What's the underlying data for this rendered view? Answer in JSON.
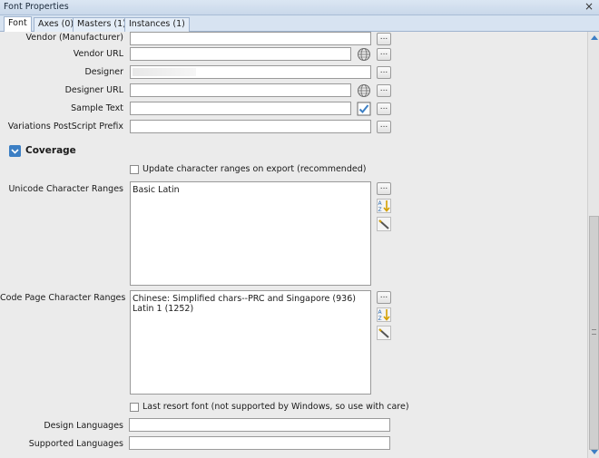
{
  "window": {
    "title": "Font Properties"
  },
  "tabs": [
    {
      "label": "Font"
    },
    {
      "label": "Axes (0)"
    },
    {
      "label": "Masters (1)"
    },
    {
      "label": "Instances (1)"
    }
  ],
  "fields": {
    "vendor": {
      "label": "Vendor (Manufacturer)",
      "value": ""
    },
    "vendor_url": {
      "label": "Vendor URL",
      "value": ""
    },
    "designer": {
      "label": "Designer",
      "value": ""
    },
    "designer_url": {
      "label": "Designer URL",
      "value": ""
    },
    "sample_text": {
      "label": "Sample Text",
      "value": ""
    },
    "variations_prefix": {
      "label": "Variations PostScript Prefix",
      "value": ""
    }
  },
  "coverage": {
    "title": "Coverage",
    "update_ranges_checkbox": {
      "label": "Update character ranges on export (recommended)",
      "checked": false
    },
    "unicode_ranges": {
      "label": "Unicode Character Ranges",
      "items": [
        "Basic Latin"
      ]
    },
    "code_page_ranges": {
      "label": "Code Page Character Ranges",
      "items": [
        "Chinese: Simplified chars--PRC and Singapore (936)",
        "Latin 1 (1252)"
      ]
    },
    "last_resort_checkbox": {
      "label": "Last resort font (not supported by Windows, so use with care)",
      "checked": false
    },
    "design_languages": {
      "label": "Design Languages",
      "value": ""
    },
    "supported_languages": {
      "label": "Supported Languages",
      "value": ""
    }
  },
  "buttons": {
    "ellipsis": "..."
  },
  "icons": {
    "close": "×",
    "globe": "globe-icon",
    "checkmark": "checkmark-icon",
    "sort": "sort-az-icon",
    "wand": "wand-icon",
    "chevron": "chevron-down-icon"
  },
  "colors": {
    "accent": "#3c7fc4",
    "titlebar": "#d2dfef"
  }
}
